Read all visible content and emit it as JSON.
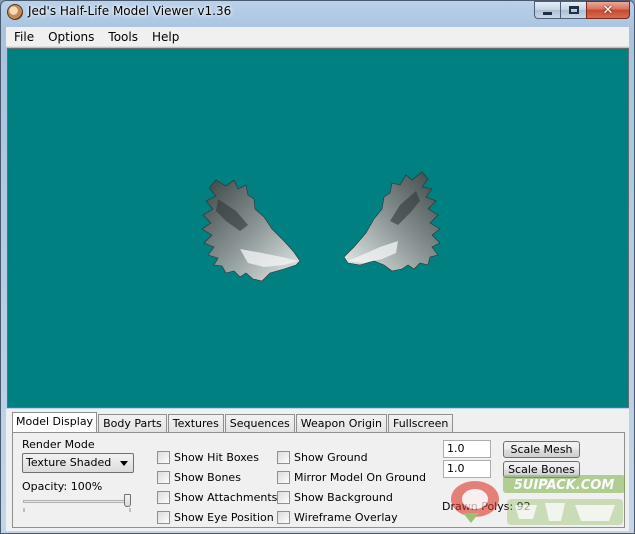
{
  "window": {
    "title": "Jed's Half-Life Model Viewer v1.36",
    "caption_buttons": {
      "minimize": "",
      "maximize": "",
      "close": "✕"
    }
  },
  "menu": [
    "File",
    "Options",
    "Tools",
    "Help"
  ],
  "viewport": {
    "background_color": "#008080",
    "model": "wings model"
  },
  "tabs": [
    "Model Display",
    "Body Parts",
    "Textures",
    "Sequences",
    "Weapon Origin",
    "Fullscreen"
  ],
  "active_tab": "Model Display",
  "display": {
    "render_mode_label": "Render Mode",
    "render_mode_value": "Texture Shaded",
    "opacity_label": "Opacity: 100%",
    "opacity_value": 100,
    "checkboxes_col1": [
      "Show Hit Boxes",
      "Show Bones",
      "Show Attachments",
      "Show Eye Position"
    ],
    "checkboxes_col2": [
      "Show Ground",
      "Mirror Model On Ground",
      "Show Background",
      "Wireframe Overlay"
    ],
    "scale_mesh_value": "1.0",
    "scale_mesh_label": "Scale Mesh",
    "scale_bones_value": "1.0",
    "scale_bones_label": "Scale Bones",
    "drawn_polys_label": "Drawn Polys: 92"
  },
  "watermark": {
    "text": "5UIPACK.COM",
    "colors": {
      "red": "#d9342b",
      "green": "#7fb24a"
    }
  }
}
